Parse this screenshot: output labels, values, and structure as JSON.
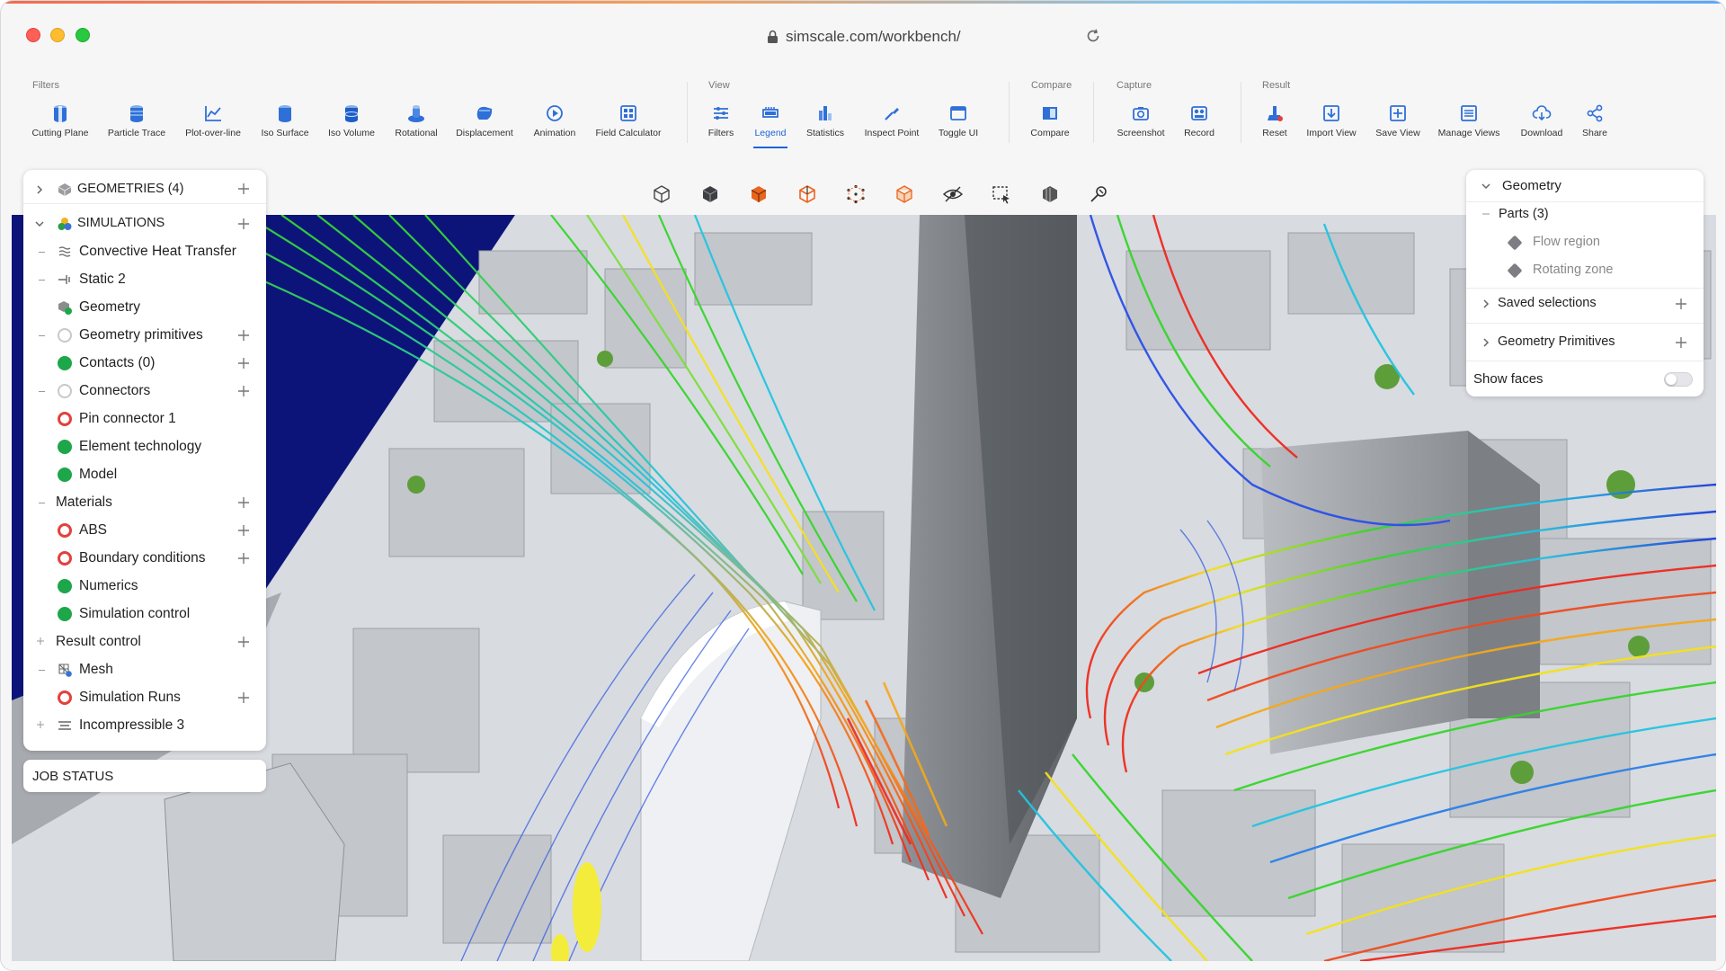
{
  "browser": {
    "url": "simscale.com/workbench/"
  },
  "toolbar": {
    "groups": {
      "filters": "Filters",
      "view": "View",
      "compare": "Compare",
      "capture": "Capture",
      "result": "Result"
    },
    "tools": [
      {
        "label": "Cutting Plane",
        "icon": "cutting-plane-icon"
      },
      {
        "label": "Particle Trace",
        "icon": "particle-trace-icon"
      },
      {
        "label": "Plot-over-line",
        "icon": "plot-over-line-icon"
      },
      {
        "label": "Iso Surface",
        "icon": "iso-surface-icon"
      },
      {
        "label": "Iso Volume",
        "icon": "iso-volume-icon"
      },
      {
        "label": "Rotational",
        "icon": "rotational-icon"
      },
      {
        "label": "Displacement",
        "icon": "displacement-icon"
      },
      {
        "label": "Animation",
        "icon": "animation-icon"
      },
      {
        "label": "Field Calculator",
        "icon": "field-calculator-icon"
      },
      {
        "label": "Filters",
        "icon": "filters-icon"
      },
      {
        "label": "Legend",
        "icon": "legend-icon"
      },
      {
        "label": "Statistics",
        "icon": "statistics-icon"
      },
      {
        "label": "Inspect Point",
        "icon": "inspect-point-icon"
      },
      {
        "label": "Toggle UI",
        "icon": "toggle-ui-icon"
      },
      {
        "label": "Compare",
        "icon": "compare-icon"
      },
      {
        "label": "Screenshot",
        "icon": "camera-icon"
      },
      {
        "label": "Record",
        "icon": "record-icon"
      },
      {
        "label": "Reset",
        "icon": "reset-icon"
      },
      {
        "label": "Import View",
        "icon": "import-view-icon"
      },
      {
        "label": "Save View",
        "icon": "save-view-icon"
      },
      {
        "label": "Manage Views",
        "icon": "manage-views-icon"
      },
      {
        "label": "Download",
        "icon": "download-icon"
      },
      {
        "label": "Share",
        "icon": "share-icon"
      }
    ],
    "active_tool": "Legend",
    "accent": "#1f63d6"
  },
  "tree": {
    "geometries": "GEOMETRIES (4)",
    "simulations": "SIMULATIONS",
    "items": [
      {
        "label": "Convective Heat Transfer"
      },
      {
        "label": "Static 2"
      },
      {
        "label": "Geometry"
      },
      {
        "label": "Geometry primitives"
      },
      {
        "label": "Contacts (0)"
      },
      {
        "label": "Connectors"
      },
      {
        "label": "Pin connector 1"
      },
      {
        "label": "Element technology"
      },
      {
        "label": "Model"
      },
      {
        "label": "Materials"
      },
      {
        "label": "ABS"
      },
      {
        "label": "Boundary conditions"
      },
      {
        "label": "Numerics"
      },
      {
        "label": "Simulation control"
      },
      {
        "label": "Result control"
      },
      {
        "label": "Mesh"
      },
      {
        "label": "Simulation Runs"
      },
      {
        "label": "Incompressible 3"
      }
    ],
    "status_colors": {
      "ok": "#1ea64a",
      "error": "#e2413b"
    }
  },
  "job_status": "JOB STATUS",
  "right_panel": {
    "header": "Geometry",
    "parts": "Parts (3)",
    "part_items": [
      "Flow region",
      "Rotating zone"
    ],
    "saved_selections": "Saved selections",
    "geometry_primitives": "Geometry Primitives",
    "show_faces": "Show faces",
    "show_faces_on": false
  }
}
